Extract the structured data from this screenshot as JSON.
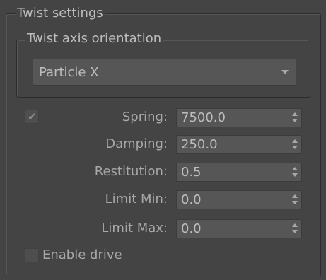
{
  "twist_settings": {
    "title": "Twist settings",
    "axis_orientation": {
      "title": "Twist axis orientation",
      "selected": "Particle X"
    },
    "spring_enabled": true,
    "fields": [
      {
        "label": "Spring:",
        "value": "7500.0"
      },
      {
        "label": "Damping:",
        "value": "250.0"
      },
      {
        "label": "Restitution:",
        "value": "0.5"
      },
      {
        "label": "Limit Min:",
        "value": "0.0"
      },
      {
        "label": "Limit Max:",
        "value": "0.0"
      }
    ],
    "enable_drive": {
      "label": "Enable drive",
      "checked": false
    },
    "checkmark_glyph": "✔"
  },
  "colors": {
    "background": "#444444",
    "field_background": "#565656",
    "text": "#bdbdbd",
    "label": "#a8a8a8"
  },
  "icons": {
    "dropdown": "chevron-down-icon",
    "spinner_up": "spin-up-icon",
    "spinner_down": "spin-down-icon",
    "check": "checkmark-icon"
  }
}
